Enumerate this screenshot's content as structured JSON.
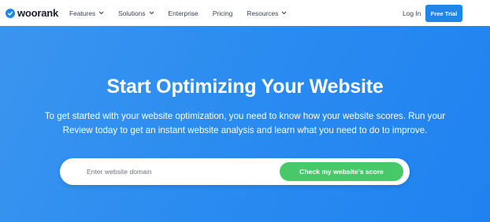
{
  "brand": {
    "name": "woorank",
    "icon": "check-circle-icon",
    "color": "#1f86e8"
  },
  "nav": {
    "items": [
      {
        "label": "Features",
        "has_dropdown": true
      },
      {
        "label": "Solutions",
        "has_dropdown": true
      },
      {
        "label": "Enterprise",
        "has_dropdown": false
      },
      {
        "label": "Pricing",
        "has_dropdown": false
      },
      {
        "label": "Resources",
        "has_dropdown": true
      }
    ],
    "login_label": "Log In",
    "trial_label": "Free Trial"
  },
  "hero": {
    "title": "Start Optimizing Your Website",
    "subtitle_line1": "To get started with your website optimization, you need to know how your website scores. Run your",
    "subtitle_line2": "Review today to get an instant website analysis and learn what you need to do to improve.",
    "search": {
      "placeholder": "Enter website domain",
      "value": ""
    },
    "cta_label": "Check my website's score"
  },
  "colors": {
    "accent": "#1f86e8",
    "hero_bg": "#2b8cf0",
    "cta": "#47c96a"
  }
}
